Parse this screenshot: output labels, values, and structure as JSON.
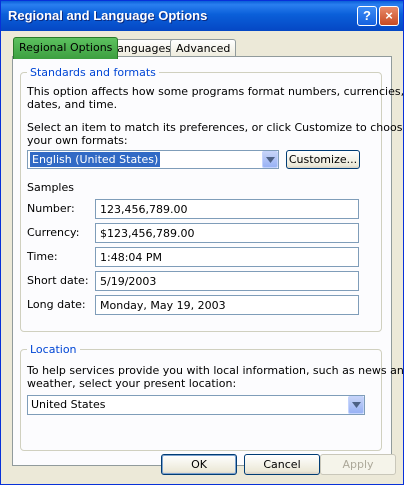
{
  "window": {
    "title": "Regional and Language Options",
    "help_label": "?",
    "close_label": "×"
  },
  "tabs": [
    {
      "label": "Regional Options",
      "active": true
    },
    {
      "label": "Languages",
      "active": false
    },
    {
      "label": "Advanced",
      "active": false
    }
  ],
  "standards": {
    "legend": "Standards and formats",
    "description_line1": "This option affects how some programs format numbers, currencies,",
    "description_line2": "dates, and time.",
    "select_line1": "Select an item to match its preferences, or click Customize to choose",
    "select_line2": "your own formats:",
    "selected_locale": "English (United States)",
    "customize_label": "Customize...",
    "samples_label": "Samples",
    "samples": [
      {
        "label": "Number:",
        "value": "123,456,789.00"
      },
      {
        "label": "Currency:",
        "value": "$123,456,789.00"
      },
      {
        "label": "Time:",
        "value": "1:48:04 PM"
      },
      {
        "label": "Short date:",
        "value": "5/19/2003"
      },
      {
        "label": "Long date:",
        "value": "Monday, May 19, 2003"
      }
    ]
  },
  "location": {
    "legend": "Location",
    "description_line1": "To help services provide you with local information, such as news and",
    "description_line2": "weather, select your present location:",
    "selected_location": "United States"
  },
  "buttons": {
    "ok": "OK",
    "cancel": "Cancel",
    "apply": "Apply"
  }
}
